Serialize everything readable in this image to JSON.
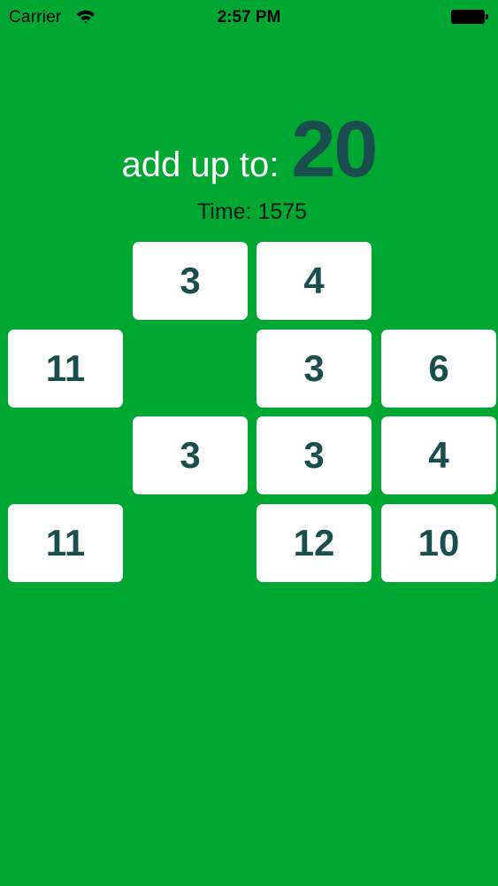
{
  "status_bar": {
    "carrier": "Carrier",
    "time": "2:57 PM"
  },
  "game": {
    "target_label": "add up to:",
    "target_value": "20",
    "timer_text": "Time: 1575"
  },
  "board": {
    "rows": [
      [
        "",
        "3",
        "4",
        ""
      ],
      [
        "11",
        "",
        "3",
        "6"
      ],
      [
        "",
        "3",
        "3",
        "4"
      ],
      [
        "11",
        "",
        "12",
        "10"
      ]
    ]
  },
  "colors": {
    "background": "#00a832",
    "tile": "#ffffff",
    "number": "#1a4d4d"
  }
}
